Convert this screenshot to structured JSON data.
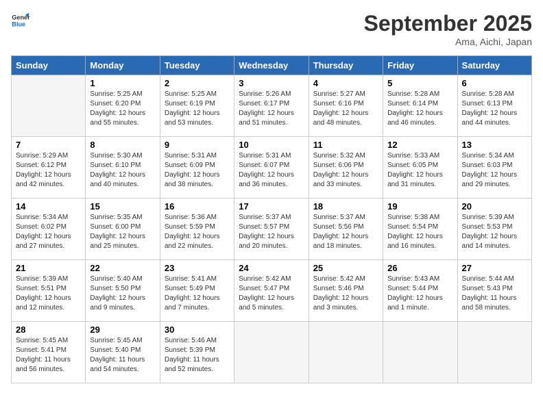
{
  "header": {
    "logo_line1": "General",
    "logo_line2": "Blue",
    "month": "September 2025",
    "location": "Ama, Aichi, Japan"
  },
  "days_of_week": [
    "Sunday",
    "Monday",
    "Tuesday",
    "Wednesday",
    "Thursday",
    "Friday",
    "Saturday"
  ],
  "weeks": [
    [
      {
        "day": "",
        "info": ""
      },
      {
        "day": "1",
        "info": "Sunrise: 5:25 AM\nSunset: 6:20 PM\nDaylight: 12 hours\nand 55 minutes."
      },
      {
        "day": "2",
        "info": "Sunrise: 5:25 AM\nSunset: 6:19 PM\nDaylight: 12 hours\nand 53 minutes."
      },
      {
        "day": "3",
        "info": "Sunrise: 5:26 AM\nSunset: 6:17 PM\nDaylight: 12 hours\nand 51 minutes."
      },
      {
        "day": "4",
        "info": "Sunrise: 5:27 AM\nSunset: 6:16 PM\nDaylight: 12 hours\nand 48 minutes."
      },
      {
        "day": "5",
        "info": "Sunrise: 5:28 AM\nSunset: 6:14 PM\nDaylight: 12 hours\nand 46 minutes."
      },
      {
        "day": "6",
        "info": "Sunrise: 5:28 AM\nSunset: 6:13 PM\nDaylight: 12 hours\nand 44 minutes."
      }
    ],
    [
      {
        "day": "7",
        "info": "Sunrise: 5:29 AM\nSunset: 6:12 PM\nDaylight: 12 hours\nand 42 minutes."
      },
      {
        "day": "8",
        "info": "Sunrise: 5:30 AM\nSunset: 6:10 PM\nDaylight: 12 hours\nand 40 minutes."
      },
      {
        "day": "9",
        "info": "Sunrise: 5:31 AM\nSunset: 6:09 PM\nDaylight: 12 hours\nand 38 minutes."
      },
      {
        "day": "10",
        "info": "Sunrise: 5:31 AM\nSunset: 6:07 PM\nDaylight: 12 hours\nand 36 minutes."
      },
      {
        "day": "11",
        "info": "Sunrise: 5:32 AM\nSunset: 6:06 PM\nDaylight: 12 hours\nand 33 minutes."
      },
      {
        "day": "12",
        "info": "Sunrise: 5:33 AM\nSunset: 6:05 PM\nDaylight: 12 hours\nand 31 minutes."
      },
      {
        "day": "13",
        "info": "Sunrise: 5:34 AM\nSunset: 6:03 PM\nDaylight: 12 hours\nand 29 minutes."
      }
    ],
    [
      {
        "day": "14",
        "info": "Sunrise: 5:34 AM\nSunset: 6:02 PM\nDaylight: 12 hours\nand 27 minutes."
      },
      {
        "day": "15",
        "info": "Sunrise: 5:35 AM\nSunset: 6:00 PM\nDaylight: 12 hours\nand 25 minutes."
      },
      {
        "day": "16",
        "info": "Sunrise: 5:36 AM\nSunset: 5:59 PM\nDaylight: 12 hours\nand 22 minutes."
      },
      {
        "day": "17",
        "info": "Sunrise: 5:37 AM\nSunset: 5:57 PM\nDaylight: 12 hours\nand 20 minutes."
      },
      {
        "day": "18",
        "info": "Sunrise: 5:37 AM\nSunset: 5:56 PM\nDaylight: 12 hours\nand 18 minutes."
      },
      {
        "day": "19",
        "info": "Sunrise: 5:38 AM\nSunset: 5:54 PM\nDaylight: 12 hours\nand 16 minutes."
      },
      {
        "day": "20",
        "info": "Sunrise: 5:39 AM\nSunset: 5:53 PM\nDaylight: 12 hours\nand 14 minutes."
      }
    ],
    [
      {
        "day": "21",
        "info": "Sunrise: 5:39 AM\nSunset: 5:51 PM\nDaylight: 12 hours\nand 12 minutes."
      },
      {
        "day": "22",
        "info": "Sunrise: 5:40 AM\nSunset: 5:50 PM\nDaylight: 12 hours\nand 9 minutes."
      },
      {
        "day": "23",
        "info": "Sunrise: 5:41 AM\nSunset: 5:49 PM\nDaylight: 12 hours\nand 7 minutes."
      },
      {
        "day": "24",
        "info": "Sunrise: 5:42 AM\nSunset: 5:47 PM\nDaylight: 12 hours\nand 5 minutes."
      },
      {
        "day": "25",
        "info": "Sunrise: 5:42 AM\nSunset: 5:46 PM\nDaylight: 12 hours\nand 3 minutes."
      },
      {
        "day": "26",
        "info": "Sunrise: 5:43 AM\nSunset: 5:44 PM\nDaylight: 12 hours\nand 1 minute."
      },
      {
        "day": "27",
        "info": "Sunrise: 5:44 AM\nSunset: 5:43 PM\nDaylight: 11 hours\nand 58 minutes."
      }
    ],
    [
      {
        "day": "28",
        "info": "Sunrise: 5:45 AM\nSunset: 5:41 PM\nDaylight: 11 hours\nand 56 minutes."
      },
      {
        "day": "29",
        "info": "Sunrise: 5:45 AM\nSunset: 5:40 PM\nDaylight: 11 hours\nand 54 minutes."
      },
      {
        "day": "30",
        "info": "Sunrise: 5:46 AM\nSunset: 5:39 PM\nDaylight: 11 hours\nand 52 minutes."
      },
      {
        "day": "",
        "info": ""
      },
      {
        "day": "",
        "info": ""
      },
      {
        "day": "",
        "info": ""
      },
      {
        "day": "",
        "info": ""
      }
    ]
  ]
}
